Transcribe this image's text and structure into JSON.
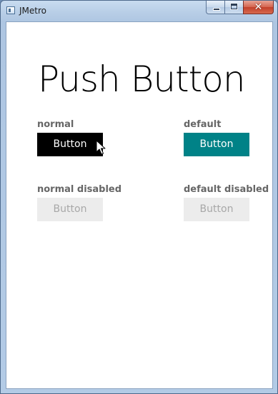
{
  "window": {
    "title": "JMetro",
    "app_icon": "window-app-icon",
    "controls": {
      "minimize_icon": "minimize-icon",
      "maximize_icon": "maximize-icon",
      "close_icon": "close-icon",
      "close_glyph": "✕"
    }
  },
  "content": {
    "title": "Push Button",
    "sections": [
      {
        "label": "normal",
        "button_label": "Button",
        "state": "enabled",
        "style": "normal"
      },
      {
        "label": "default",
        "button_label": "Button",
        "state": "enabled",
        "style": "default"
      },
      {
        "label": "normal disabled",
        "button_label": "Button",
        "state": "disabled",
        "style": "normal"
      },
      {
        "label": "default disabled",
        "button_label": "Button",
        "state": "disabled",
        "style": "default"
      }
    ]
  },
  "colors": {
    "normal_button_bg": "#000000",
    "default_button_bg": "#008287",
    "disabled_button_bg": "#ececec",
    "disabled_text": "#a8a8a8",
    "label_text": "#666666"
  },
  "cursor": {
    "icon": "mouse-pointer-icon"
  }
}
